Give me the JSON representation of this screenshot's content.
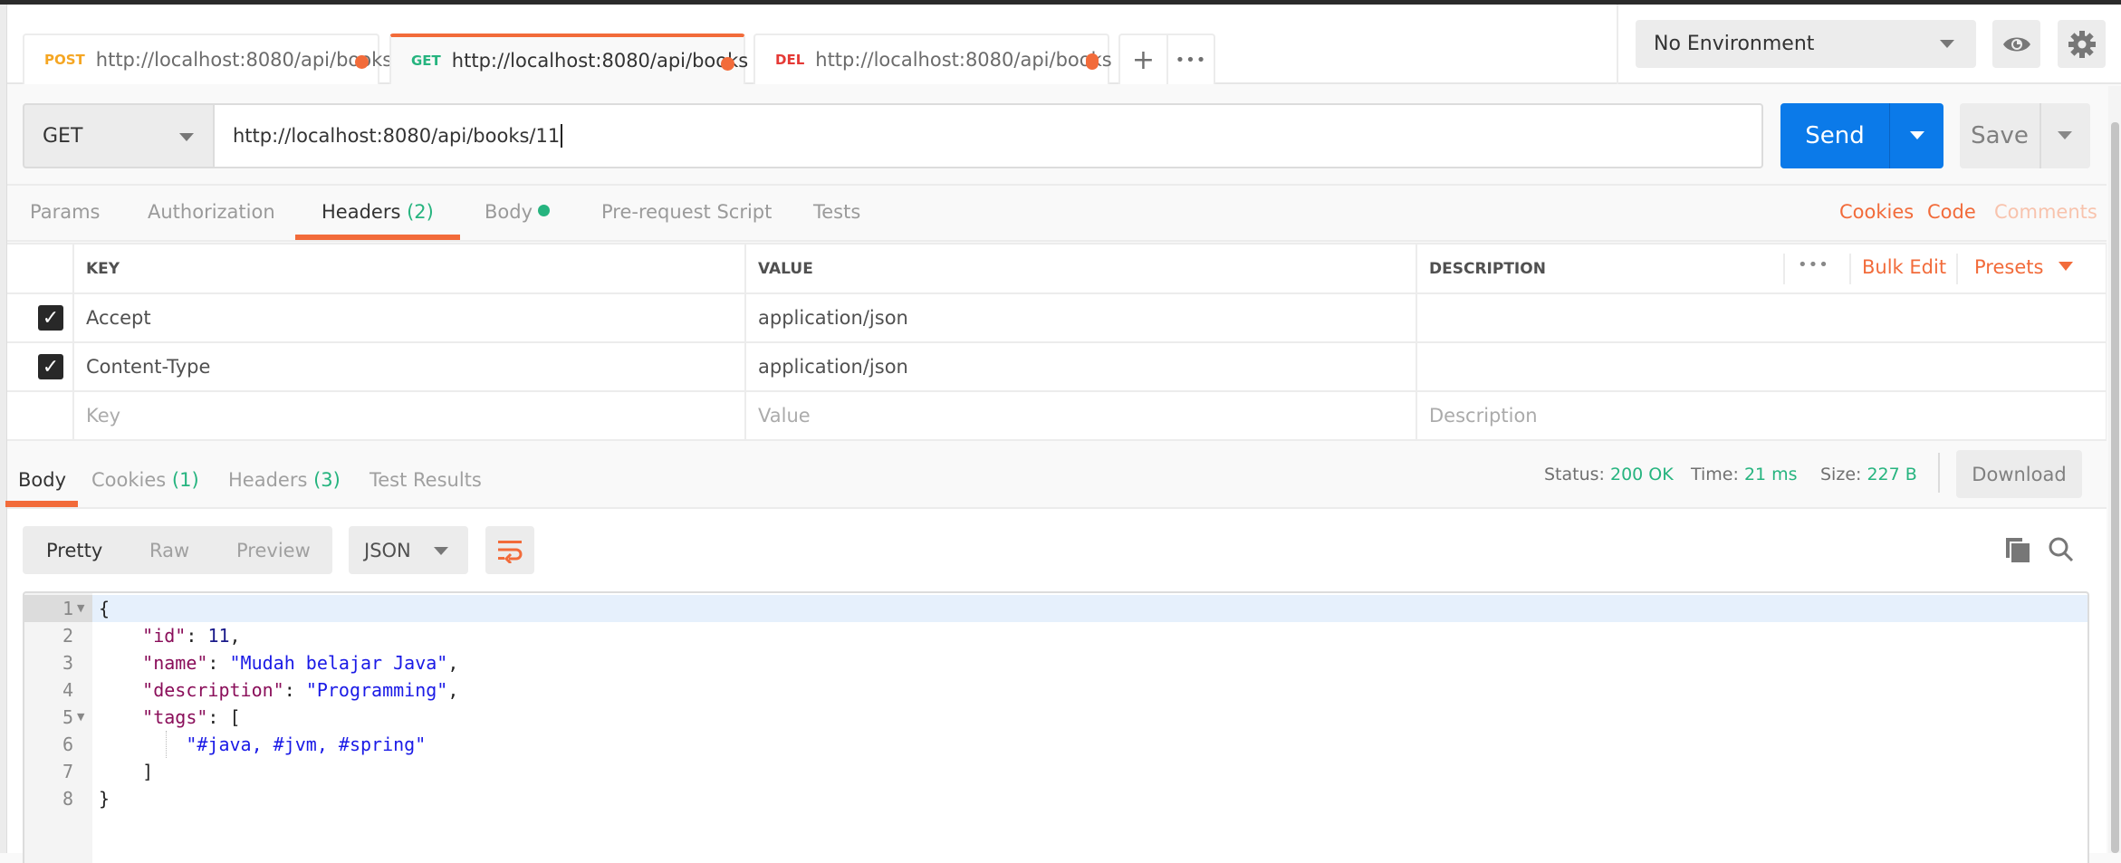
{
  "request_tabs": [
    {
      "method": "POST",
      "method_color": "#f5a623",
      "url": "http://localhost:8080/api/books",
      "unsaved": true,
      "active": false
    },
    {
      "method": "GET",
      "method_color": "#26b47f",
      "url": "http://localhost:8080/api/books",
      "unsaved": true,
      "active": true
    },
    {
      "method": "DEL",
      "method_color": "#e53935",
      "url": "http://localhost:8080/api/books",
      "unsaved": true,
      "active": false
    }
  ],
  "tab_actions": {
    "new_tab_icon": "+",
    "more_icon": "•••"
  },
  "environment": {
    "selected": "No Environment",
    "eye_icon": "eye-icon",
    "settings_icon": "gear-icon"
  },
  "request": {
    "method": "GET",
    "url": "http://localhost:8080/api/books/11",
    "send_label": "Send",
    "save_label": "Save"
  },
  "request_subtabs": [
    {
      "label": "Params"
    },
    {
      "label": "Authorization"
    },
    {
      "label": "Headers",
      "count": "(2)",
      "active": true
    },
    {
      "label": "Body",
      "has_indicator": true
    },
    {
      "label": "Pre-request Script"
    },
    {
      "label": "Tests"
    }
  ],
  "request_links": {
    "cookies": "Cookies",
    "code": "Code",
    "comments": "Comments"
  },
  "headers_table": {
    "columns": {
      "key": "KEY",
      "value": "VALUE",
      "description": "DESCRIPTION"
    },
    "actions": {
      "more": "•••",
      "bulk_edit": "Bulk Edit",
      "presets": "Presets"
    },
    "rows": [
      {
        "enabled": true,
        "key": "Accept",
        "value": "application/json",
        "description": ""
      },
      {
        "enabled": true,
        "key": "Content-Type",
        "value": "application/json",
        "description": ""
      }
    ],
    "placeholders": {
      "key": "Key",
      "value": "Value",
      "description": "Description"
    }
  },
  "response_tabs": [
    {
      "label": "Body",
      "active": true
    },
    {
      "label": "Cookies",
      "count": "(1)"
    },
    {
      "label": "Headers",
      "count": "(3)"
    },
    {
      "label": "Test Results"
    }
  ],
  "response_meta": {
    "status_label": "Status:",
    "status": "200 OK",
    "time_label": "Time:",
    "time": "21 ms",
    "size_label": "Size:",
    "size": "227 B",
    "download_label": "Download"
  },
  "body_view": {
    "modes": [
      "Pretty",
      "Raw",
      "Preview"
    ],
    "active_mode": "Pretty",
    "format": "JSON"
  },
  "response_body": {
    "lines": [
      {
        "num": "1",
        "fold": true
      },
      {
        "num": "2"
      },
      {
        "num": "3"
      },
      {
        "num": "4"
      },
      {
        "num": "5",
        "fold": true
      },
      {
        "num": "6"
      },
      {
        "num": "7"
      },
      {
        "num": "8"
      }
    ],
    "tokens": {
      "open_brace": "{",
      "id_key": "\"id\"",
      "id_val": "11",
      "name_key": "\"name\"",
      "name_val": "\"Mudah belajar Java\"",
      "desc_key": "\"description\"",
      "desc_val": "\"Programming\"",
      "tags_key": "\"tags\"",
      "open_bracket": "[",
      "tag_val": "\"#java, #jvm, #spring\"",
      "close_bracket": "]",
      "close_brace": "}"
    }
  },
  "colors": {
    "accent": "#f26b3a",
    "primary": "#0b7ae9",
    "success": "#26b47f"
  }
}
